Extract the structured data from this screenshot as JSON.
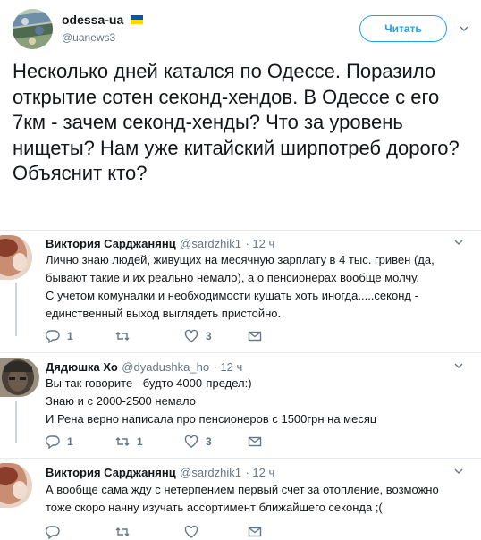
{
  "header": {
    "display_name": "odessa-ua",
    "handle": "@uanews3",
    "follow_label": "Читать",
    "flag_colors": [
      "#0057b7",
      "#ffd700"
    ]
  },
  "tweet": {
    "text": "Несколько дней катался по Одессе. Поразило открытие сотен секонд-хендов. В Одессе с его 7км - зачем секонд-хенды? Что за уровень нищеты? Нам уже китайский ширпотреб дорого? Объяснит кто?"
  },
  "replies": [
    {
      "name": "Виктория Сарджанянц",
      "handle": "@sardzhik1",
      "time": "· 12 ч",
      "lines": [
        "Лично знаю людей, живущих на месячную зарплату в 4 тыс. гривен (да,",
        "бывают такие и их реально немало), а о пенсионерах вообще молчу.",
        "С учетом комуналки и необходимости кушать хоть иногда.....секонд -",
        "единственный выход выглядеть пристойно."
      ],
      "reply_count": "1",
      "retweet_count": "",
      "like_count": "3"
    },
    {
      "name": "Дядюшка Хо",
      "handle": "@dyadushka_ho",
      "time": "· 12 ч",
      "lines": [
        "Вы так говорите - будто 4000-предел:)",
        "Знаю и с 2000-2500 немало",
        "И Рена верно написала про пенсионеров с 1500грн на месяц"
      ],
      "reply_count": "1",
      "retweet_count": "1",
      "like_count": "3"
    },
    {
      "name": "Виктория Сарджанянц",
      "handle": "@sardzhik1",
      "time": "· 12 ч",
      "lines": [
        "А вообще сама жду с нетерпением первый  счет за отопление, возможно",
        "тоже скоро начну изучать ассортимент ближайшего секонда ;("
      ],
      "reply_count": "",
      "retweet_count": "",
      "like_count": ""
    }
  ],
  "icons": {
    "reply": "reply-icon",
    "retweet": "retweet-icon",
    "like": "heart-icon",
    "dm": "envelope-icon",
    "more": "chevron-down-icon"
  },
  "colors": {
    "accent": "#1da1f2",
    "muted": "#657786",
    "divider": "#e6ecf0",
    "thread": "#ccd6dd"
  }
}
